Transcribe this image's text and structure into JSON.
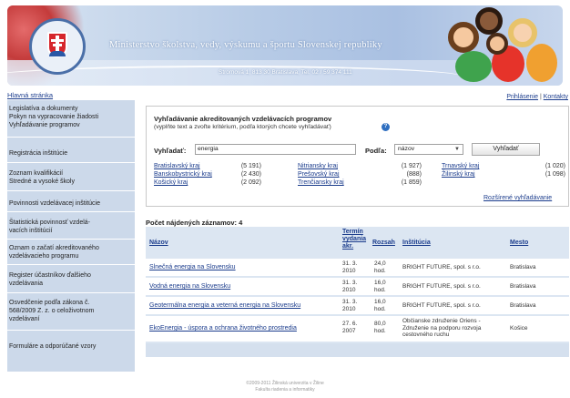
{
  "header": {
    "title": "Ministerstvo školstva, vedy, výskumu a športu Slovenskej republiky",
    "address": "Stromová 1, 813 30 Bratislava, Tel. 02 / 59 374 111"
  },
  "nav": {
    "home": "Hlavná stránka",
    "login": "Prihlásenie",
    "separator": "|",
    "contacts": "Kontakty"
  },
  "sidebar": {
    "items": [
      {
        "lines": [
          "Legislatíva a dokumenty",
          "Pokyn na vypracovanie žiadosti",
          "Vyhľadávanie programov"
        ]
      },
      {
        "lines": [
          "Registrácia inštitúcie"
        ]
      },
      {
        "lines": [
          "Zoznam kvalifikácií",
          "Stredné a vysoké školy"
        ]
      },
      {
        "lines": [
          "Povinnosti vzdelávacej inštitúcie"
        ]
      },
      {
        "lines": [
          "Štatistická povinnosť vzdelá-",
          "vacích inštitúcií"
        ]
      },
      {
        "lines": [
          "Oznam o začatí akreditovaného",
          "vzdelávacieho programu"
        ]
      },
      {
        "lines": [
          "Register účastníkov ďalšieho",
          "vzdelávania"
        ]
      },
      {
        "lines": [
          "Osvedčenie podľa zákona č.",
          "568/2009 Z. z. o celoživotnom",
          "vzdelávaní"
        ]
      },
      {
        "lines": [
          "Formuláre a odporúčané vzory"
        ]
      }
    ]
  },
  "search": {
    "title": "Vyhľadávanie akreditovaných vzdelávacích programov",
    "hint": "(vyplňte text a zvoľte kritérium, podľa ktorých chcete vyhľadávať)",
    "help_icon": "?",
    "search_label": "Vyhľadať:",
    "search_value": "energia",
    "by_label": "Podľa:",
    "by_value": "názov",
    "button": "Vyhľadať",
    "regions": [
      {
        "name": "Bratislavský kraj",
        "count": "(5 191)"
      },
      {
        "name": "Banskobystrický kraj",
        "count": "(2 430)"
      },
      {
        "name": "Košický kraj",
        "count": "(2 092)"
      },
      {
        "name": "Nitriansky kraj",
        "count": "(1 927)"
      },
      {
        "name": "Prešovský kraj",
        "count": "(888)"
      },
      {
        "name": "Trenčiansky kraj",
        "count": "(1 859)"
      },
      {
        "name": "Trnavský kraj",
        "count": "(1 020)"
      },
      {
        "name": "Žilinský kraj",
        "count": "(1 098)"
      }
    ],
    "advanced": "Rozšírené vyhľadávanie"
  },
  "results": {
    "count_label": "Počet nájdených záznamov: 4",
    "headers": {
      "name": "Názov",
      "term": [
        "Termín",
        "vydania",
        "akr."
      ],
      "scope": "Rozsah",
      "institution": "Inštitúcia",
      "city": "Mesto"
    },
    "rows": [
      {
        "name": "Slnečná energia na Slovensku",
        "term": [
          "31. 3.",
          "2010"
        ],
        "scope": [
          "24,0",
          "hod."
        ],
        "institution": [
          "BRIGHT FUTURE, spol. s r.o."
        ],
        "city": "Bratislava"
      },
      {
        "name": "Vodná energia na Slovensku",
        "term": [
          "31. 3.",
          "2010"
        ],
        "scope": [
          "16,0",
          "hod."
        ],
        "institution": [
          "BRIGHT FUTURE, spol. s r.o."
        ],
        "city": "Bratislava"
      },
      {
        "name": "Geotermálna energia a veterná energia na Slovensku",
        "term": [
          "31. 3.",
          "2010"
        ],
        "scope": [
          "16,0",
          "hod."
        ],
        "institution": [
          "BRIGHT FUTURE, spol. s r.o."
        ],
        "city": "Bratislava"
      },
      {
        "name": "EkoEnergia - úspora a ochrana životného prostredia",
        "term": [
          "27. 6.",
          "2007"
        ],
        "scope": [
          "80,0",
          "hod."
        ],
        "institution": [
          "Občianske združenie Oriens -",
          "Združenie na podporu rozvoja",
          "cestovného ruchu"
        ],
        "city": "Košice"
      }
    ]
  },
  "footer": {
    "line1": "©2009-2011 Žilinská univerzita v Žiline",
    "line2": "Fakulta riadenia a informatiky"
  },
  "colors": {
    "link": "#1b3c8c",
    "sidebar_bg": "#ccd9ea",
    "table_bg": "#dce6f2"
  }
}
